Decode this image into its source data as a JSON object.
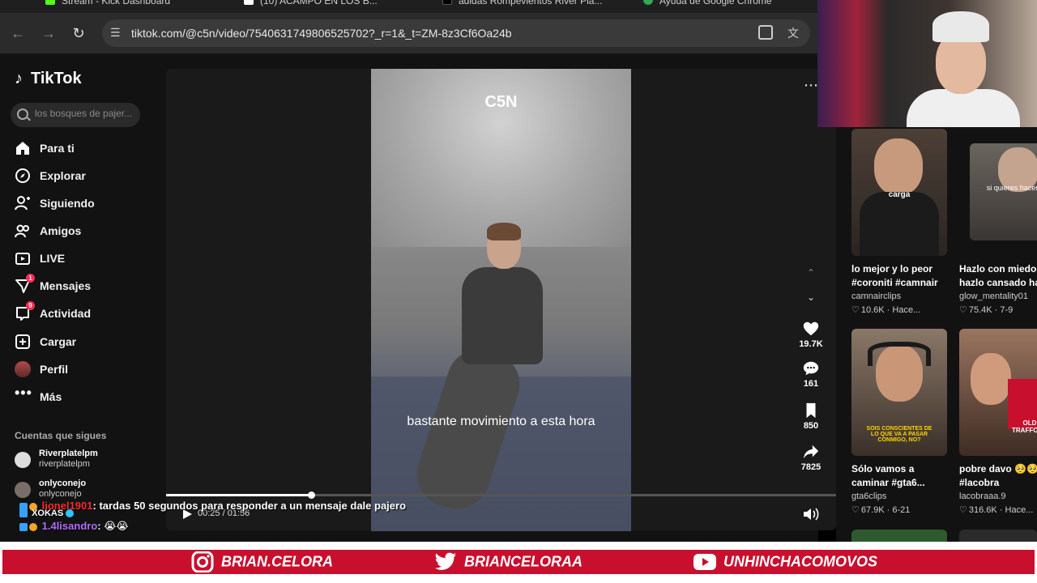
{
  "browser": {
    "tabs": [
      {
        "label": "Stream - Kick Dashboard",
        "color": "#53fc18"
      },
      {
        "label": "(10) ACAMPO EN LOS B...",
        "color": "#ffffff"
      },
      {
        "label": "adidas Rompevientos River Pla...",
        "color": "#000000"
      },
      {
        "label": "Ayuda de Google Chrome",
        "color": "#34a853"
      }
    ],
    "url": "tiktok.com/@c5n/video/7540631749806525702?_r=1&_t=ZM-8z3Cf6Oa24b"
  },
  "tiktok": {
    "logo": "TikTok",
    "search_placeholder": "los bosques de pajer...",
    "nav": [
      {
        "label": "Para ti",
        "icon": "home-icon"
      },
      {
        "label": "Explorar",
        "icon": "compass-icon"
      },
      {
        "label": "Siguiendo",
        "icon": "following-icon"
      },
      {
        "label": "Amigos",
        "icon": "friends-icon"
      },
      {
        "label": "LIVE",
        "icon": "live-icon"
      },
      {
        "label": "Mensajes",
        "icon": "messages-icon",
        "badge": "1"
      },
      {
        "label": "Actividad",
        "icon": "activity-icon",
        "badge": "9"
      },
      {
        "label": "Cargar",
        "icon": "upload-icon"
      },
      {
        "label": "Perfil",
        "icon": "profile-avatar"
      },
      {
        "label": "Más",
        "icon": "more-icon"
      }
    ],
    "follows_title": "Cuentas que sigues",
    "follows": [
      {
        "name": "Riverplatelpm",
        "handle": "riverplatelpm"
      },
      {
        "name": "onlyconejo",
        "handle": "onlyconejo"
      }
    ]
  },
  "video": {
    "watermark": "C5N",
    "caption": "bastante movimiento a esta hora",
    "likes": "19.7K",
    "comments": "161",
    "saves": "850",
    "shares": "7825",
    "current_time": "00:25",
    "duration": "01:56",
    "progress": 0.217
  },
  "chat": [
    {
      "user": "lionel1901",
      "user_color": "#ff2a2a",
      "message": ": tardas 50 segundos para responder a un mensaje dale pajero"
    },
    {
      "user": "XOKAS",
      "user_color": "#ffffff",
      "message": ""
    },
    {
      "user": "1.4lisandro",
      "user_color": "#b46cff",
      "message": ": 😭😭"
    }
  ],
  "recommendations": [
    {
      "title": "lo mejor y lo peor",
      "tags": "#coroniti #camnair",
      "author": "camnairclips",
      "stats": "10.6K · Hace...",
      "overlay": "carga",
      "bg": "#5a4a3e"
    },
    {
      "title": "Hazlo con miedo",
      "tags": "hazlo cansado ha",
      "author": "glow_mentality01",
      "stats": "75.4K · 7-9",
      "overlay": "si quieres hacer",
      "bg": "#5b5752"
    },
    {
      "title": "Sólo vamos a",
      "tags": "caminar #gta6...",
      "author": "gta6clips",
      "stats": "67.9K · 6-21",
      "overlay": "SOIS CONSCIENTES DE LO QUE VA A PASAR CONMIGO, NO?",
      "bg": "#6b5a4c"
    },
    {
      "title": "pobre davo 🥺🥺",
      "tags": "#lacobra",
      "author": "lacobraaa.9",
      "stats": "316.6K · Hace...",
      "overlay": "OLD TRAFFORD",
      "bg": "#7a5a48"
    }
  ],
  "banner": {
    "instagram": "BRIAN.CELORA",
    "twitter": "BRIANCELORAA",
    "youtube": "UNHINCHACOMOVOS",
    "color": "#c8102e"
  }
}
